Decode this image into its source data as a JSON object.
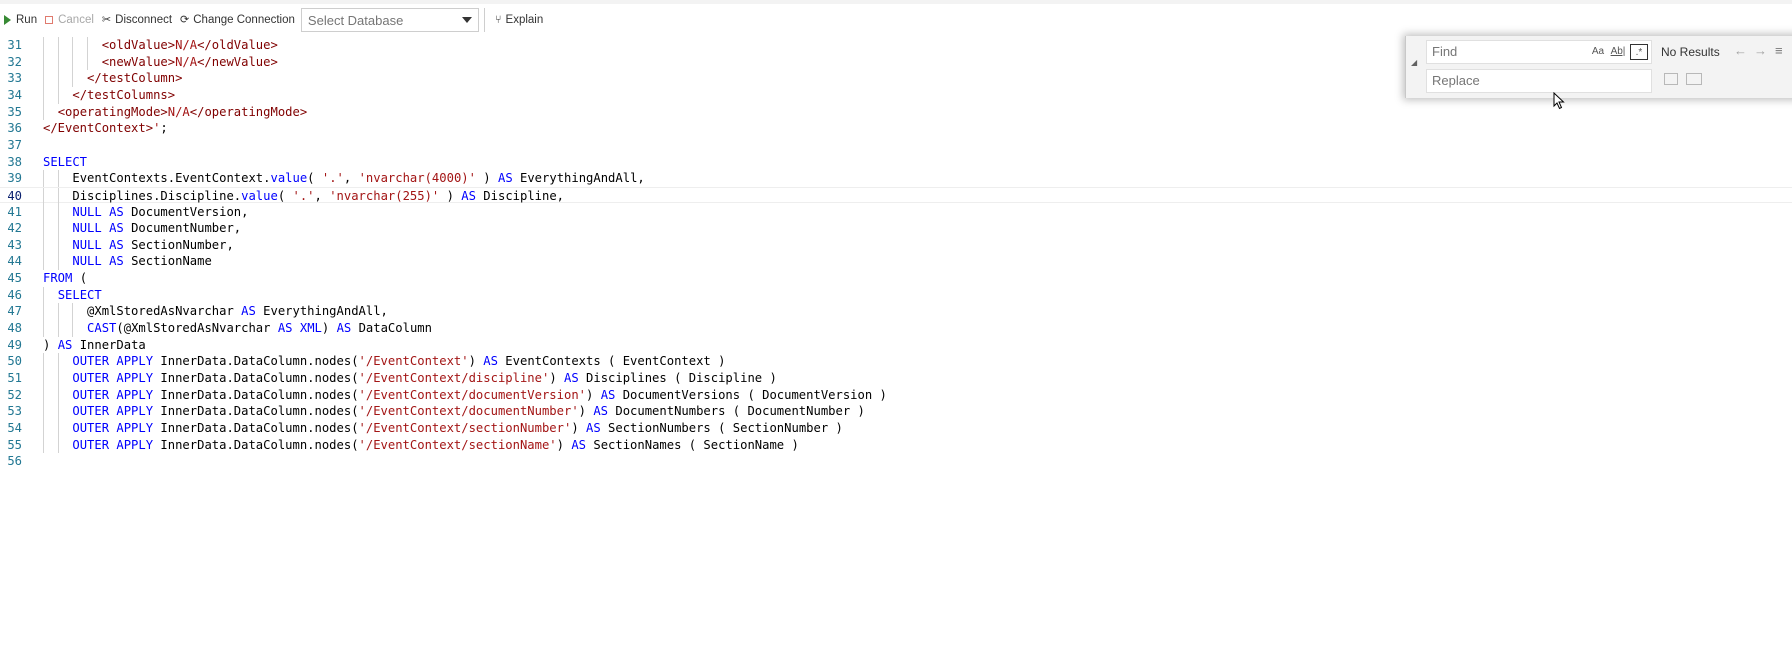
{
  "toolbar": {
    "run": "Run",
    "cancel": "Cancel",
    "disconnect": "Disconnect",
    "change_connection": "Change Connection",
    "database_placeholder": "Select Database",
    "explain": "Explain"
  },
  "find_widget": {
    "find_placeholder": "Find",
    "replace_placeholder": "Replace",
    "match_case": "Aa",
    "whole_word": "Ab|",
    "regex": ".*",
    "status": "No Results"
  },
  "editor": {
    "current_line": "40",
    "lines": [
      {
        "n": "31",
        "indent": "        ",
        "segs": [
          [
            "tag",
            "<oldValue>"
          ],
          [
            "val",
            "N/A"
          ],
          [
            "tag",
            "</oldValue>"
          ]
        ]
      },
      {
        "n": "32",
        "indent": "        ",
        "segs": [
          [
            "tag",
            "<newValue>"
          ],
          [
            "val",
            "N/A"
          ],
          [
            "tag",
            "</newValue>"
          ]
        ]
      },
      {
        "n": "33",
        "indent": "      ",
        "segs": [
          [
            "tag",
            "</testColumn>"
          ]
        ]
      },
      {
        "n": "34",
        "indent": "    ",
        "segs": [
          [
            "tag",
            "</testColumns>"
          ]
        ]
      },
      {
        "n": "35",
        "indent": "  ",
        "segs": [
          [
            "tag",
            "<operatingMode>"
          ],
          [
            "val",
            "N/A"
          ],
          [
            "tag",
            "</operatingMode>"
          ]
        ]
      },
      {
        "n": "36",
        "indent": "",
        "segs": [
          [
            "tag",
            "</EventContext>"
          ],
          [
            "str",
            "'"
          ],
          [
            "plain",
            ";"
          ]
        ]
      },
      {
        "n": "37",
        "indent": "",
        "segs": []
      },
      {
        "n": "38",
        "indent": "",
        "segs": [
          [
            "kw",
            "SELECT"
          ]
        ]
      },
      {
        "n": "39",
        "indent": "    ",
        "segs": [
          [
            "plain",
            "EventContexts.EventContext."
          ],
          [
            "kw",
            "value"
          ],
          [
            "plain",
            "( "
          ],
          [
            "str",
            "'.'"
          ],
          [
            "plain",
            ", "
          ],
          [
            "str",
            "'nvarchar(4000)'"
          ],
          [
            "plain",
            " ) "
          ],
          [
            "kw",
            "AS"
          ],
          [
            "plain",
            " EverythingAndAll,"
          ]
        ]
      },
      {
        "n": "40",
        "indent": "    ",
        "segs": [
          [
            "plain",
            "Disciplines.Discipline."
          ],
          [
            "kw",
            "value"
          ],
          [
            "plain",
            "( "
          ],
          [
            "str",
            "'.'"
          ],
          [
            "plain",
            ", "
          ],
          [
            "str",
            "'nvarchar(255)'"
          ],
          [
            "plain",
            " ) "
          ],
          [
            "kw",
            "AS"
          ],
          [
            "plain",
            " Discipline,"
          ]
        ]
      },
      {
        "n": "41",
        "indent": "    ",
        "segs": [
          [
            "kw",
            "NULL"
          ],
          [
            "plain",
            " "
          ],
          [
            "kw",
            "AS"
          ],
          [
            "plain",
            " DocumentVersion,"
          ]
        ]
      },
      {
        "n": "42",
        "indent": "    ",
        "segs": [
          [
            "kw",
            "NULL"
          ],
          [
            "plain",
            " "
          ],
          [
            "kw",
            "AS"
          ],
          [
            "plain",
            " DocumentNumber,"
          ]
        ]
      },
      {
        "n": "43",
        "indent": "    ",
        "segs": [
          [
            "kw",
            "NULL"
          ],
          [
            "plain",
            " "
          ],
          [
            "kw",
            "AS"
          ],
          [
            "plain",
            " SectionNumber,"
          ]
        ]
      },
      {
        "n": "44",
        "indent": "    ",
        "segs": [
          [
            "kw",
            "NULL"
          ],
          [
            "plain",
            " "
          ],
          [
            "kw",
            "AS"
          ],
          [
            "plain",
            " SectionName"
          ]
        ]
      },
      {
        "n": "45",
        "indent": "",
        "segs": [
          [
            "kw",
            "FROM"
          ],
          [
            "plain",
            " ("
          ]
        ]
      },
      {
        "n": "46",
        "indent": "  ",
        "segs": [
          [
            "kw",
            "SELECT"
          ]
        ]
      },
      {
        "n": "47",
        "indent": "      ",
        "segs": [
          [
            "plain",
            "@XmlStoredAsNvarchar "
          ],
          [
            "kw",
            "AS"
          ],
          [
            "plain",
            " EverythingAndAll,"
          ]
        ]
      },
      {
        "n": "48",
        "indent": "      ",
        "segs": [
          [
            "kw",
            "CAST"
          ],
          [
            "plain",
            "(@XmlStoredAsNvarchar "
          ],
          [
            "kw",
            "AS"
          ],
          [
            "plain",
            " "
          ],
          [
            "kw",
            "XML"
          ],
          [
            "plain",
            ") "
          ],
          [
            "kw",
            "AS"
          ],
          [
            "plain",
            " DataColumn"
          ]
        ]
      },
      {
        "n": "49",
        "indent": "",
        "segs": [
          [
            "plain",
            ") "
          ],
          [
            "kw",
            "AS"
          ],
          [
            "plain",
            " InnerData"
          ]
        ]
      },
      {
        "n": "50",
        "indent": "    ",
        "segs": [
          [
            "kw",
            "OUTER APPLY"
          ],
          [
            "plain",
            " InnerData.DataColumn.nodes("
          ],
          [
            "str",
            "'/EventContext'"
          ],
          [
            "plain",
            ") "
          ],
          [
            "kw",
            "AS"
          ],
          [
            "plain",
            " EventContexts ( EventContext )"
          ]
        ]
      },
      {
        "n": "51",
        "indent": "    ",
        "segs": [
          [
            "kw",
            "OUTER APPLY"
          ],
          [
            "plain",
            " InnerData.DataColumn.nodes("
          ],
          [
            "str",
            "'/EventContext/discipline'"
          ],
          [
            "plain",
            ") "
          ],
          [
            "kw",
            "AS"
          ],
          [
            "plain",
            " Disciplines ( Discipline )"
          ]
        ]
      },
      {
        "n": "52",
        "indent": "    ",
        "segs": [
          [
            "kw",
            "OUTER APPLY"
          ],
          [
            "plain",
            " InnerData.DataColumn.nodes("
          ],
          [
            "str",
            "'/EventContext/documentVersion'"
          ],
          [
            "plain",
            ") "
          ],
          [
            "kw",
            "AS"
          ],
          [
            "plain",
            " DocumentVersions ( DocumentVersion )"
          ]
        ]
      },
      {
        "n": "53",
        "indent": "    ",
        "segs": [
          [
            "kw",
            "OUTER APPLY"
          ],
          [
            "plain",
            " InnerData.DataColumn.nodes("
          ],
          [
            "str",
            "'/EventContext/documentNumber'"
          ],
          [
            "plain",
            ") "
          ],
          [
            "kw",
            "AS"
          ],
          [
            "plain",
            " DocumentNumbers ( DocumentNumber )"
          ]
        ]
      },
      {
        "n": "54",
        "indent": "    ",
        "segs": [
          [
            "kw",
            "OUTER APPLY"
          ],
          [
            "plain",
            " InnerData.DataColumn.nodes("
          ],
          [
            "str",
            "'/EventContext/sectionNumber'"
          ],
          [
            "plain",
            ") "
          ],
          [
            "kw",
            "AS"
          ],
          [
            "plain",
            " SectionNumbers ( SectionNumber )"
          ]
        ]
      },
      {
        "n": "55",
        "indent": "    ",
        "segs": [
          [
            "kw",
            "OUTER APPLY"
          ],
          [
            "plain",
            " InnerData.DataColumn.nodes("
          ],
          [
            "str",
            "'/EventContext/sectionName'"
          ],
          [
            "plain",
            ") "
          ],
          [
            "kw",
            "AS"
          ],
          [
            "plain",
            " SectionNames ( SectionName )"
          ]
        ]
      },
      {
        "n": "56",
        "indent": "",
        "segs": []
      }
    ]
  }
}
